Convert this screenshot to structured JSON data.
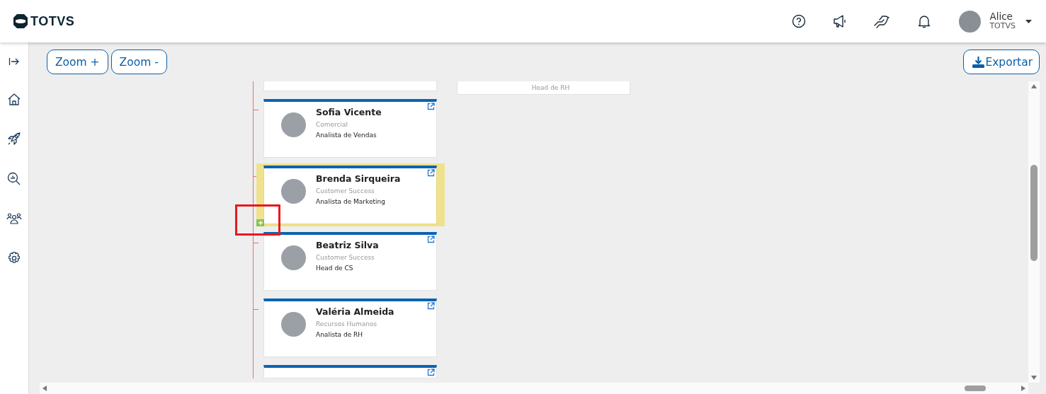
{
  "header": {
    "logo": "TOTVS",
    "user": {
      "name": "Alice",
      "company": "TOTVS"
    }
  },
  "toolbar": {
    "buttons": [
      "Zoom +",
      "Zoom -"
    ],
    "export": "Exportar"
  },
  "org_chart": {
    "columns": [
      {
        "cards": [
          {
            "kind": "partial-top"
          },
          {
            "kind": "person",
            "name": "Sofia Vicente",
            "department": "Comercial",
            "role": "Analista de Vendas",
            "selected": false,
            "expandable": false
          },
          {
            "kind": "person",
            "name": "Brenda Sirqueira",
            "department": "Customer Success",
            "role": "Analista de Marketing",
            "selected": true,
            "expandable": true
          },
          {
            "kind": "person",
            "name": "Beatriz Silva",
            "department": "Customer Success",
            "role": "Head de CS",
            "selected": false,
            "expandable": false
          },
          {
            "kind": "person",
            "name": "Valéria Almeida",
            "department": "Recursos Humanos",
            "role": "Analista de RH",
            "selected": false,
            "expandable": false
          },
          {
            "kind": "partial-bottom"
          }
        ]
      },
      {
        "cards": [
          {
            "kind": "partial-top",
            "role": "Head de RH"
          }
        ]
      }
    ]
  }
}
